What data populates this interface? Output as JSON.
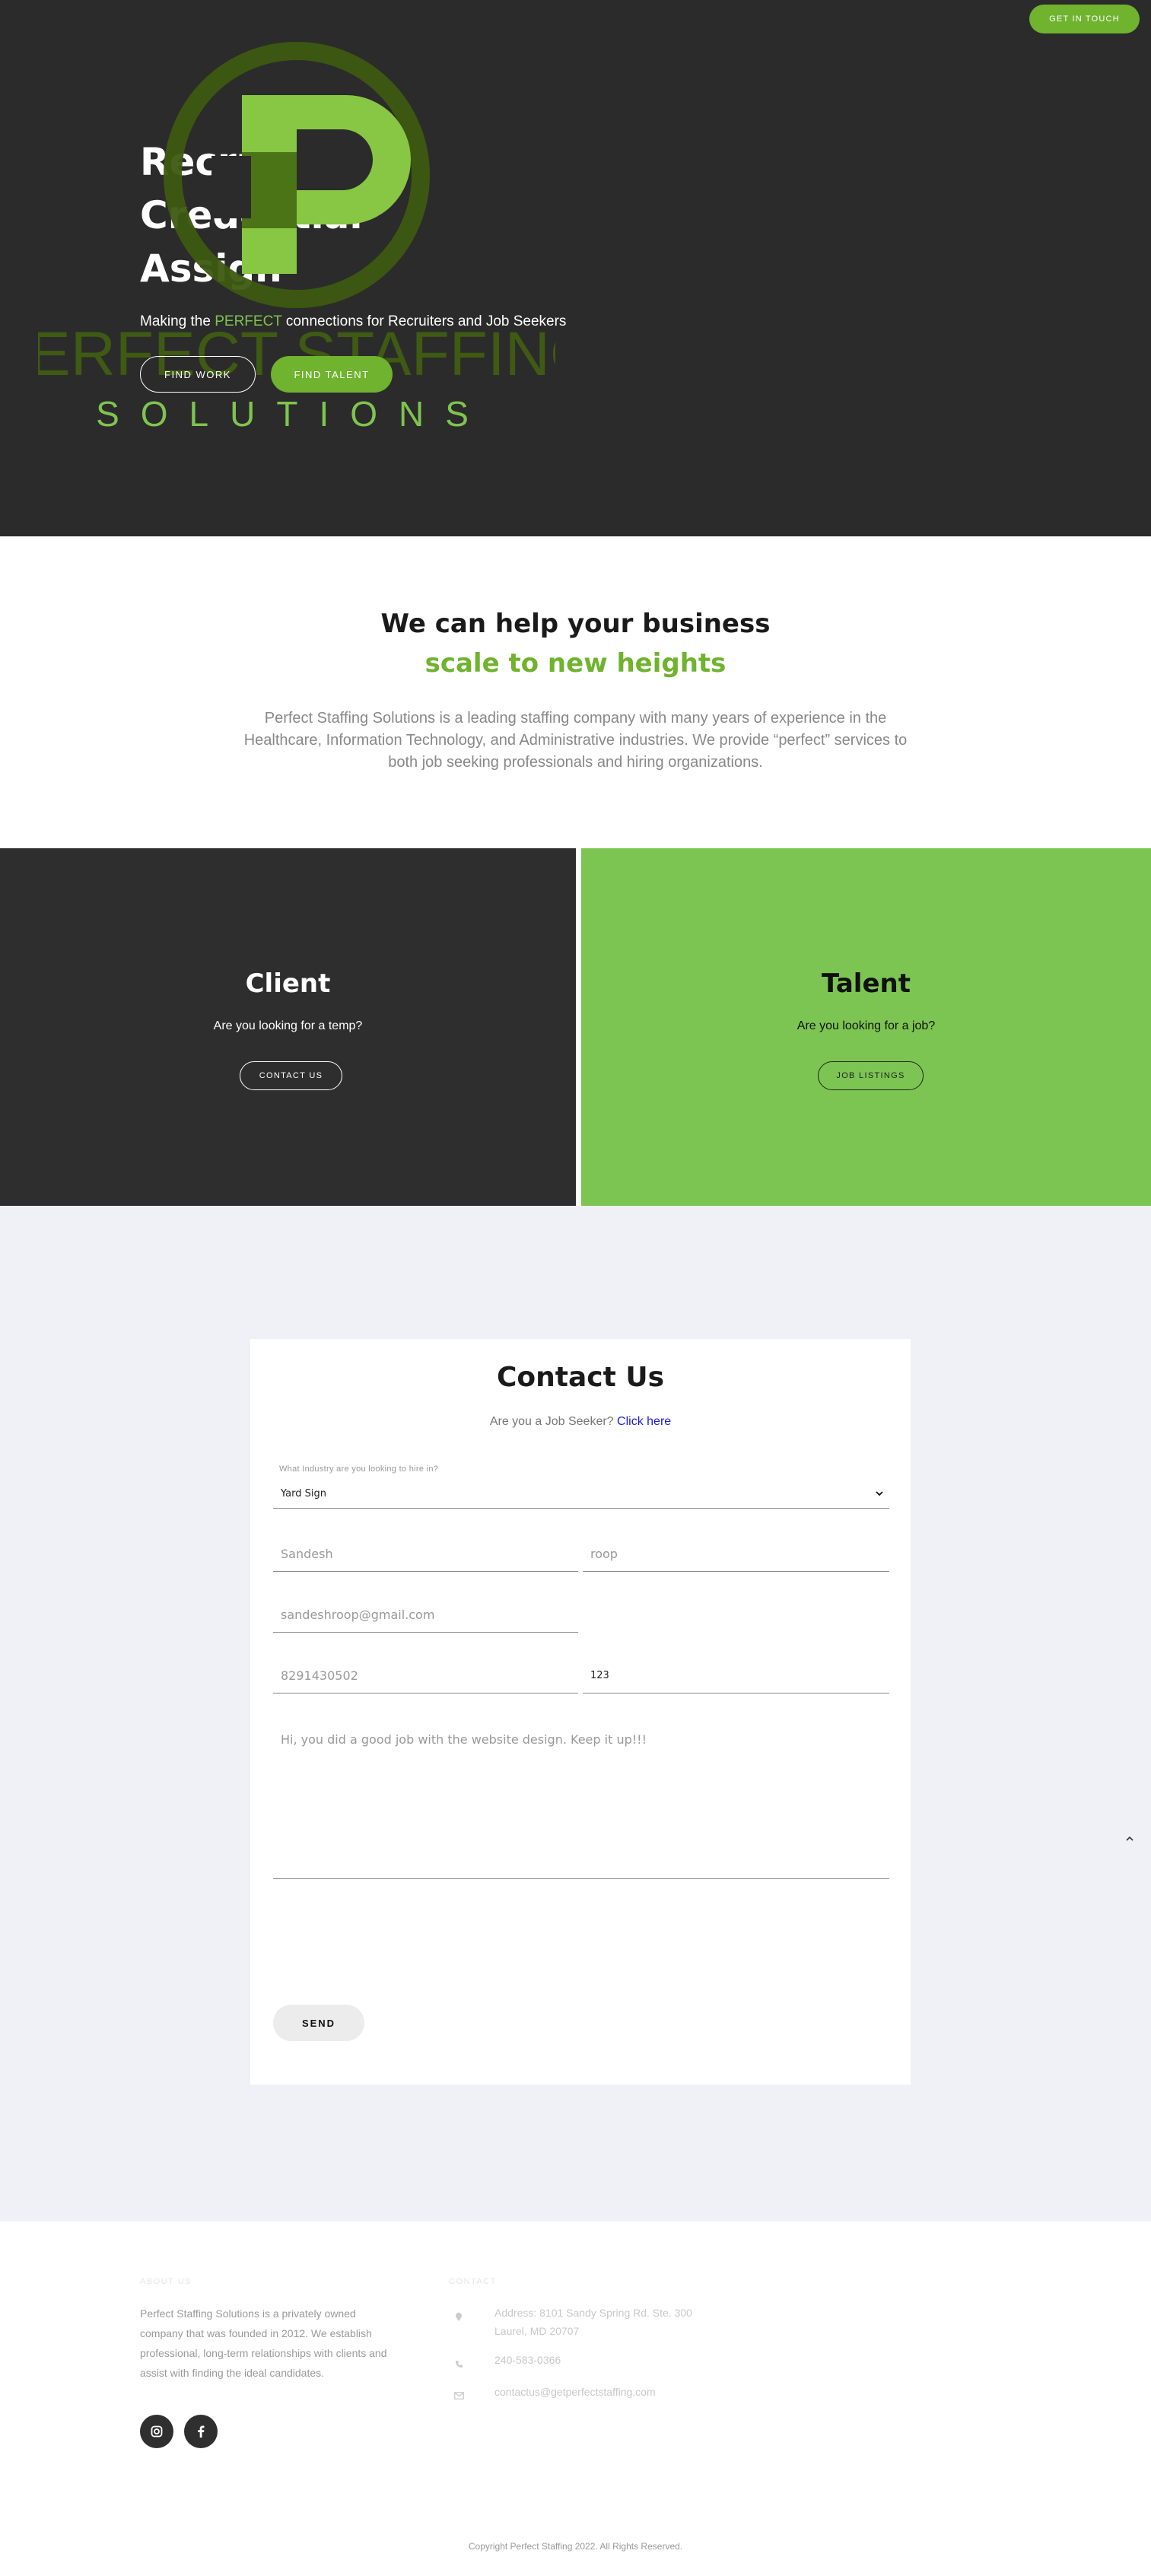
{
  "header": {
    "cta_label": "GET IN TOUCH"
  },
  "hero": {
    "title_lines": [
      "Recruit",
      "Credential",
      "Assign"
    ],
    "subtitle_before": "Making the ",
    "subtitle_accent": "PERFECT",
    "subtitle_after": " connections for Recruiters and Job Seekers",
    "find_work_label": "FIND WORK",
    "find_talent_label": "FIND TALENT",
    "logo_text_top": "PERFECT STAFFING",
    "logo_text_bottom": "SOLUTIONS"
  },
  "help": {
    "heading": "We can help your business",
    "heading_accent": "scale to new heights",
    "body": "Perfect Staffing Solutions is a leading staffing company with many years of experience in the Healthcare, Information Technology, and Administrative industries. We provide “perfect” services to both job seeking professionals and hiring organizations."
  },
  "client": {
    "title": "Client",
    "question": "Are you looking for a temp?",
    "button": "CONTACT US"
  },
  "talent": {
    "title": "Talent",
    "question": "Are you looking for a job?",
    "button": "JOB LISTINGS"
  },
  "contact": {
    "title": "Contact Us",
    "seeker_text": "Are you a Job Seeker? ",
    "seeker_link": "Click here",
    "industry_label": "What Industry are you looking to hire in?",
    "industry_value": "Yard Sign",
    "first_name": "Sandesh",
    "last_name": "roop",
    "email": "sandeshroop@gmail.com",
    "phone": "8291430502",
    "ext": "123",
    "message": "Hi, you did a good job with the website design. Keep it up!!!",
    "send_label": "SEND"
  },
  "footer": {
    "about_heading": "ABOUT US",
    "about_text": "Perfect Staffing Solutions is a privately owned company that was founded in 2012. We establish professional, long-term relationships with clients and assist with finding the ideal candidates.",
    "contact_heading": "CONTACT",
    "address_line1": "Address: 8101 Sandy Spring Rd. Ste. 300",
    "address_line2": "Laurel, MD 20707",
    "phone": "240-583-0366",
    "email": "contactus@getperfectstaffing.com",
    "copyright": "Copyright Perfect Staffing 2022. All Rights Reserved."
  },
  "colors": {
    "accent": "#6fb32e",
    "hero_bg": "#2b2b2b",
    "talent_bg": "#7dc552",
    "contact_bg": "#f0f1f6"
  }
}
